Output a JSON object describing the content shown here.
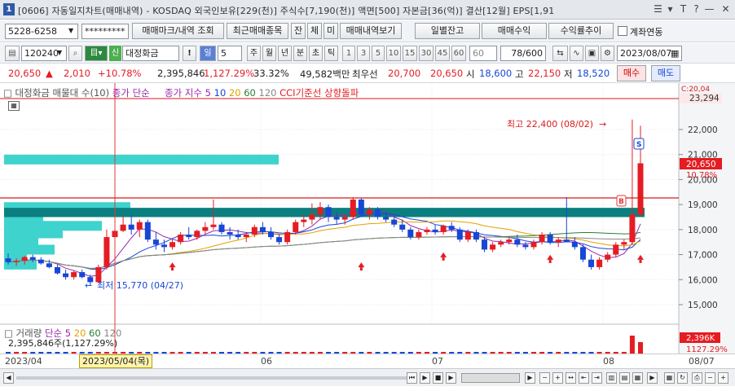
{
  "window": {
    "icon": "1",
    "title": "[0606] 자동일지차트(매매내역) - KOSDAQ 외국인보유[229(천)] 주식수[7,190(천)] 액면[500] 자본금[36(억)] 결산[12월] EPS[1,91",
    "controls": [
      "☰",
      "▾",
      "T",
      "?",
      "—",
      "✕"
    ]
  },
  "toolbar": {
    "account": "5228-6258",
    "password": "*********",
    "btn_mark": "매매마크/내역 조회",
    "btn_recent": "최근매매종목",
    "btn_jan": "잔",
    "btn_che": "체",
    "btn_mi": "미",
    "btn_history": "매매내역보기",
    "btn_daily": "일별잔고",
    "btn_profit": "매매수익",
    "btn_rate": "수익률추이",
    "chk_link": "계좌연동"
  },
  "chartbar": {
    "code": "120240",
    "stock": "대정화금",
    "shin": "신",
    "period_btn": "일",
    "period_val": "5",
    "periods": [
      "주",
      "월",
      "년",
      "분",
      "초",
      "틱"
    ],
    "intervals": [
      "1",
      "3",
      "5",
      "10",
      "15",
      "30",
      "45",
      "60",
      "60"
    ],
    "count": "78/600",
    "date": "2023/08/07"
  },
  "quote": {
    "price": "20,650",
    "arrow": "▲",
    "change": "2,010",
    "change_pct": "+10.78%",
    "volume": "2,395,846",
    "vol_pct": "1,127.29%",
    "turnover": "33.32%",
    "amount": "49,582백만",
    "bid_label": "최우선",
    "bid": "20,700",
    "ask": "20,650",
    "open_label": "시",
    "open": "18,600",
    "high_label": "고",
    "high": "22,150",
    "low_label": "저",
    "low": "18,520",
    "buy": "매수",
    "sell": "매도"
  },
  "legend": {
    "marker": "□",
    "item1": "대정화금 매물대 수(10)",
    "item2": "종가 단순",
    "item3": "종가 지수 5",
    "item3b": "10",
    "item3c": "20",
    "item3d": "60",
    "item3e": "120",
    "item4": "CCI기준선 상향돌파"
  },
  "annotations": {
    "max_label": "최고 22,400 (08/02)",
    "min_label": "최저 15,770 (04/27)",
    "price_tag": "20,650",
    "pct_tag": "10.78%",
    "top_tag": "23,294",
    "top_cut": "C:20,04",
    "marker_b": "B",
    "marker_s": "S"
  },
  "yaxis": [
    "22,000",
    "21,000",
    "20,000",
    "19,000",
    "18,000",
    "17,000",
    "16,000",
    "15,000"
  ],
  "volume": {
    "legend": "거래량",
    "ma_label": "단순",
    "ma_vals": [
      "5",
      "20",
      "60",
      "120"
    ],
    "sub": "2,395,846주(1,127.29%)",
    "tag_value": "2,396K",
    "tag_pct": "1127.29%"
  },
  "xaxis": {
    "labels": [
      "2023/04",
      "06",
      "07",
      "08",
      "08/07"
    ],
    "cursor_date": "2023/05/04(목)"
  },
  "colors": {
    "up": "#e51c23",
    "down": "#1747d6",
    "turquoise": "#3fd3cd",
    "teal": "#0b7f7f",
    "level": "#d81b1b"
  },
  "chart_data": {
    "type": "candlestick",
    "candles": [
      [
        16.85,
        17.05,
        16.6,
        16.7
      ],
      [
        16.7,
        16.85,
        16.55,
        16.75
      ],
      [
        16.75,
        16.95,
        16.6,
        16.9
      ],
      [
        16.9,
        17.0,
        16.7,
        16.8
      ],
      [
        16.8,
        16.9,
        16.6,
        16.65
      ],
      [
        16.65,
        16.8,
        16.45,
        16.5
      ],
      [
        16.5,
        16.6,
        16.2,
        16.25
      ],
      [
        16.25,
        16.4,
        16.0,
        16.1
      ],
      [
        16.1,
        16.35,
        16.0,
        16.3
      ],
      [
        16.3,
        16.4,
        16.05,
        16.1
      ],
      [
        16.1,
        16.2,
        15.77,
        15.9
      ],
      [
        15.9,
        16.6,
        15.85,
        16.5
      ],
      [
        16.5,
        18.0,
        16.4,
        17.7
      ],
      [
        17.7,
        18.2,
        17.5,
        17.95
      ],
      [
        17.95,
        18.55,
        17.9,
        18.2
      ],
      [
        18.2,
        18.6,
        17.8,
        18.0
      ],
      [
        18.0,
        18.4,
        17.7,
        18.3
      ],
      [
        18.3,
        18.4,
        17.5,
        17.6
      ],
      [
        17.6,
        17.9,
        17.2,
        17.4
      ],
      [
        17.4,
        17.6,
        17.1,
        17.3
      ],
      [
        17.3,
        17.6,
        17.2,
        17.5
      ],
      [
        17.5,
        17.9,
        17.4,
        17.8
      ],
      [
        17.8,
        18.1,
        17.6,
        17.7
      ],
      [
        17.7,
        18.0,
        17.6,
        17.95
      ],
      [
        17.95,
        18.3,
        17.8,
        18.1
      ],
      [
        18.1,
        19.2,
        18.0,
        18.2
      ],
      [
        18.2,
        18.3,
        17.8,
        17.9
      ],
      [
        17.9,
        18.1,
        17.6,
        17.8
      ],
      [
        17.8,
        18.0,
        17.6,
        17.7
      ],
      [
        17.7,
        17.9,
        17.5,
        17.8
      ],
      [
        17.8,
        18.2,
        17.7,
        18.1
      ],
      [
        18.1,
        18.3,
        17.8,
        17.9
      ],
      [
        17.9,
        18.1,
        17.6,
        17.7
      ],
      [
        17.7,
        17.8,
        17.4,
        17.5
      ],
      [
        17.5,
        18.0,
        17.4,
        17.9
      ],
      [
        17.9,
        18.4,
        17.8,
        18.3
      ],
      [
        18.3,
        18.6,
        18.1,
        18.4
      ],
      [
        18.4,
        19.05,
        18.2,
        18.6
      ],
      [
        18.6,
        19.1,
        18.4,
        18.9
      ],
      [
        18.9,
        19.0,
        18.3,
        18.5
      ],
      [
        18.5,
        18.7,
        18.2,
        18.4
      ],
      [
        18.4,
        18.6,
        18.2,
        18.5
      ],
      [
        18.5,
        19.3,
        18.4,
        19.2
      ],
      [
        19.2,
        19.25,
        18.5,
        18.6
      ],
      [
        18.6,
        18.9,
        18.4,
        18.8
      ],
      [
        18.8,
        18.9,
        18.4,
        18.5
      ],
      [
        18.5,
        18.7,
        18.3,
        18.4
      ],
      [
        18.4,
        18.5,
        18.1,
        18.2
      ],
      [
        18.2,
        18.4,
        17.9,
        18.0
      ],
      [
        18.0,
        18.1,
        17.6,
        17.7
      ],
      [
        17.7,
        18.0,
        17.6,
        17.9
      ],
      [
        17.9,
        18.1,
        17.8,
        18.0
      ],
      [
        18.0,
        18.2,
        17.8,
        17.9
      ],
      [
        17.9,
        18.2,
        17.8,
        18.15
      ],
      [
        18.15,
        18.3,
        17.9,
        18.0
      ],
      [
        18.0,
        18.1,
        17.5,
        17.6
      ],
      [
        17.6,
        18.0,
        17.5,
        17.9
      ],
      [
        17.9,
        18.0,
        17.5,
        17.6
      ],
      [
        17.6,
        17.7,
        17.1,
        17.2
      ],
      [
        17.2,
        17.5,
        17.1,
        17.4
      ],
      [
        17.4,
        17.6,
        17.3,
        17.5
      ],
      [
        17.5,
        17.7,
        17.4,
        17.6
      ],
      [
        17.6,
        17.8,
        17.3,
        17.4
      ],
      [
        17.4,
        17.5,
        17.2,
        17.3
      ],
      [
        17.3,
        17.6,
        17.2,
        17.5
      ],
      [
        17.5,
        17.9,
        17.4,
        17.8
      ],
      [
        17.8,
        17.9,
        17.4,
        17.5
      ],
      [
        17.5,
        17.7,
        17.3,
        17.6
      ],
      [
        17.6,
        19.3,
        17.5,
        17.5
      ],
      [
        17.5,
        17.7,
        17.2,
        17.3
      ],
      [
        17.3,
        17.4,
        16.7,
        16.8
      ],
      [
        16.8,
        17.0,
        16.4,
        16.5
      ],
      [
        16.5,
        16.9,
        16.4,
        16.8
      ],
      [
        16.8,
        17.1,
        16.7,
        17.0
      ],
      [
        17.0,
        17.5,
        16.9,
        17.4
      ],
      [
        17.4,
        17.6,
        17.2,
        17.5
      ],
      [
        17.5,
        22.4,
        17.4,
        18.6
      ],
      [
        18.6,
        22.15,
        18.52,
        20.65
      ]
    ],
    "volume_last": "2,395,846"
  }
}
